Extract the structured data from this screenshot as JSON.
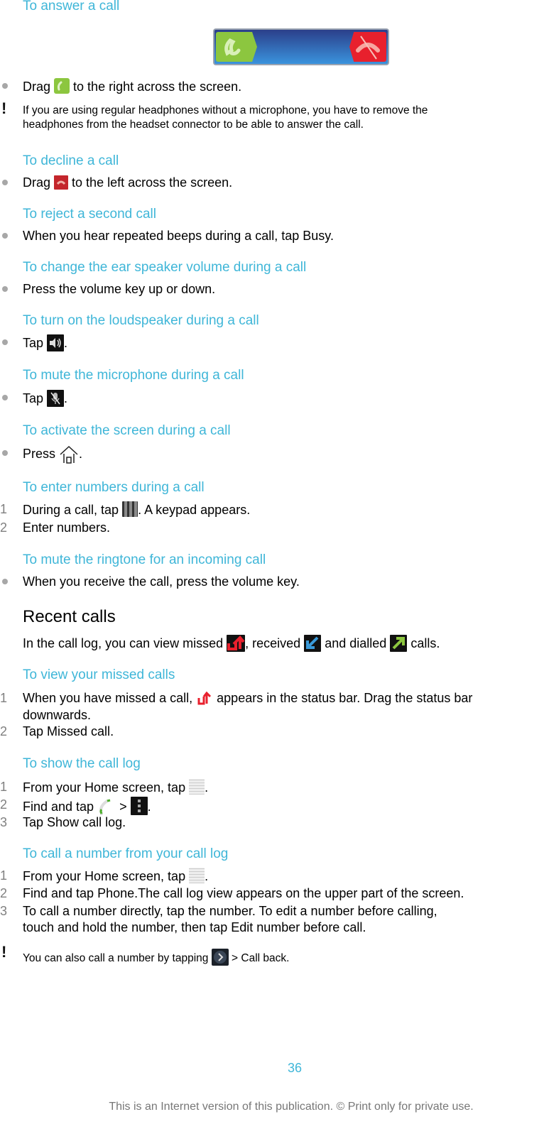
{
  "sections": {
    "answer": {
      "heading": "To answer a call",
      "step_pre": "Drag",
      "step_post": "to the right across the screen.",
      "note": "If you are using regular headphones without a microphone, you have to remove the",
      "note_line2": "headphones from the headset connector to be able to answer the call."
    },
    "decline": {
      "heading": "To decline a call",
      "step_pre": "Drag",
      "step_post": "to the left across the screen."
    },
    "reject": {
      "heading": "To reject a second call",
      "step_pre": "When you hear repeated beeps during a call, tap ",
      "step_bold": "Busy",
      "step_post": "."
    },
    "volume": {
      "heading": "To change the ear speaker volume during a call",
      "step": "Press the volume key up or down."
    },
    "loudspeaker": {
      "heading": "To turn on the loudspeaker during a call",
      "step_pre": "Tap",
      "step_post": "."
    },
    "mute_mic": {
      "heading": "To mute the microphone during a call",
      "step_pre": "Tap",
      "step_post": "."
    },
    "activate": {
      "heading": "To activate the screen during a call",
      "step_pre": "Press",
      "step_post": "."
    },
    "numbers": {
      "heading": "To enter numbers during a call",
      "steps": [
        {
          "num": "1",
          "pre": "During a call, tap",
          "post": ". A keypad appears."
        },
        {
          "num": "2",
          "text": "Enter numbers."
        }
      ]
    },
    "ringtone": {
      "heading": "To mute the ringtone for an incoming call",
      "step": "When you receive the call, press the volume key."
    },
    "recent": {
      "title": "Recent calls",
      "intro_1": "In the call log, you can view missed",
      "intro_2": ", received",
      "intro_3": "and dialled",
      "intro_4": "calls."
    },
    "missed": {
      "heading": "To view your missed calls",
      "steps": [
        {
          "num": "1",
          "pre": "When you have missed a call,",
          "post": "appears in the status bar. Drag the status bar",
          "cont": "downwards."
        },
        {
          "num": "2",
          "pre": "Tap ",
          "bold": "Missed call",
          "post": "."
        }
      ]
    },
    "show_log": {
      "heading": "To show the call log",
      "steps": [
        {
          "num": "1",
          "pre": "From your Home screen, tap",
          "post": "."
        },
        {
          "num": "2",
          "pre": "Find and tap",
          "mid": ">",
          "post": "."
        },
        {
          "num": "3",
          "pre": "Tap ",
          "bold": "Show call log",
          "post": "."
        }
      ]
    },
    "call_from_log": {
      "heading": "To call a number from your call log",
      "steps": [
        {
          "num": "1",
          "pre": "From your Home screen, tap",
          "post": "."
        },
        {
          "num": "2",
          "pre": "Find and tap ",
          "bold": "Phone",
          "post": ".The call log view appears on the upper part of the screen."
        },
        {
          "num": "3",
          "pre": "To call a number directly, tap the number. To edit a number before calling,",
          "cont_pre": "touch and hold the number, then tap ",
          "bold": "Edit number before call",
          "post": "."
        }
      ],
      "note_pre": "You can also call a number by tapping",
      "note_mid": "> ",
      "note_bold": "Call back",
      "note_post": "."
    }
  },
  "footer": {
    "page_number": "36",
    "notice": "This is an Internet version of this publication. © Print only for private use."
  },
  "colors": {
    "heading": "#3fb6d8",
    "answer_green": "#8cc63f",
    "decline_red": "#e8202d",
    "slider_blue": "#2a62b0"
  },
  "icons": {
    "answer": "phone-answer-icon",
    "decline": "phone-decline-icon",
    "speaker": "speaker-icon",
    "mic_mute": "mic-mute-icon",
    "home": "home-icon",
    "keypad": "keypad-icon",
    "missed": "missed-call-icon",
    "received": "received-call-icon",
    "dialled": "dialled-call-icon",
    "apps": "app-grid-icon",
    "phone": "phone-icon",
    "menu": "menu-icon",
    "arrow": "arrow-right-icon",
    "warning": "exclamation-icon"
  }
}
